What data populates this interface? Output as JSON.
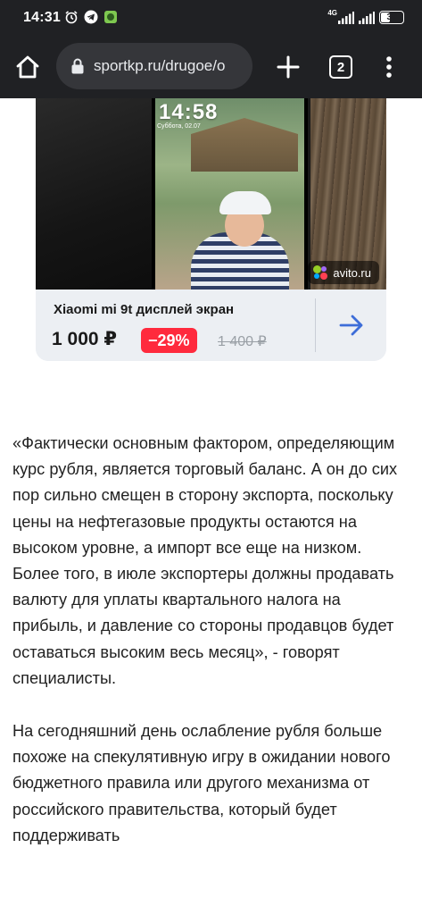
{
  "status_bar": {
    "time": "14:31",
    "network": "4G",
    "battery": "39",
    "battery_level": 0.39
  },
  "browser": {
    "url": "sportkp.ru/drugoe/o",
    "tab_count": "2"
  },
  "ad": {
    "lockscreen_time": "14:58",
    "lockscreen_date": "Суббота, 02.07",
    "source": "avito.ru",
    "title": "Xiaomi mi 9t дисплей экран",
    "price": "1 000 ₽",
    "discount": "−29%",
    "old_price": "1 400 ₽"
  },
  "article": {
    "paragraphs": [
      "«Фактически основным фактором, определяющим курс рубля, является торговый баланс. А он до сих пор сильно смещен в сторону экспорта, поскольку цены на нефтегазовые продукты остаются на высоком уровне, а импорт все еще на низком. Более того, в июле экспортеры должны продавать валюту для уплаты квартального налога на прибыль, и давление со стороны продавцов будет оставаться высоким весь месяц», - говорят специалисты.",
      "На сегодняшний день ослабление рубля больше похоже на спекулятивную игру в ожидании нового бюджетного правила или другого механизма от российского правительства, который будет поддерживать"
    ]
  },
  "colors": {
    "chrome_bar": "#202124",
    "url_bar": "#35363a",
    "discount_red": "#ff2a3d",
    "arrow_blue": "#3d6dd8",
    "ad_bg": "#eceff3"
  },
  "icons": {
    "home": "home-icon",
    "lock": "lock-icon",
    "new_tab": "plus-icon",
    "menu": "kebab-menu-icon",
    "arrow": "arrow-right-icon"
  }
}
